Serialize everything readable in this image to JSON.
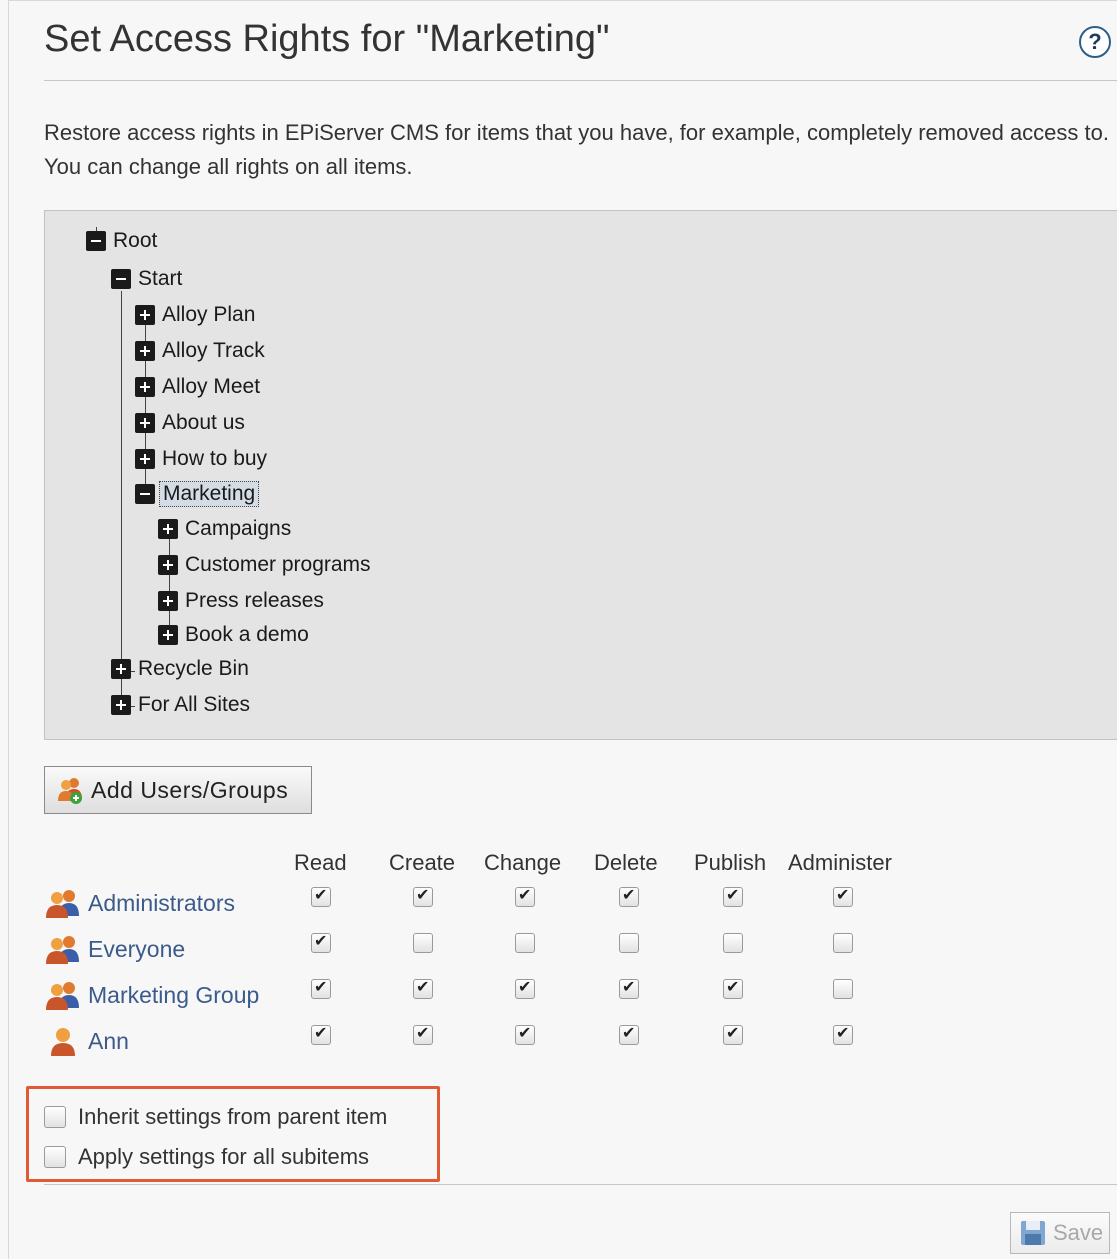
{
  "dialog": {
    "title": "Set Access Rights for \"Marketing\"",
    "help_icon": "?",
    "description": "Restore access rights in EPiServer CMS for items that you have, for example, completely removed access to. You can change all rights on all items."
  },
  "tree": {
    "root": "Root",
    "start": "Start",
    "start_children": [
      "Alloy Plan",
      "Alloy Track",
      "Alloy Meet",
      "About us",
      "How to buy"
    ],
    "selected": "Marketing",
    "marketing_children": [
      "Campaigns",
      "Customer programs",
      "Press releases",
      "Book a demo"
    ],
    "root_children_after": [
      "Recycle Bin",
      "For All Sites"
    ]
  },
  "add_button": {
    "label": "Add Users/Groups",
    "icon": "add-group-icon"
  },
  "permissions": {
    "columns": [
      "Read",
      "Create",
      "Change",
      "Delete",
      "Publish",
      "Administer"
    ],
    "rows": [
      {
        "name": "Administrators",
        "type": "group",
        "checks": [
          true,
          true,
          true,
          true,
          true,
          true
        ]
      },
      {
        "name": "Everyone",
        "type": "group",
        "checks": [
          true,
          false,
          false,
          false,
          false,
          false
        ]
      },
      {
        "name": "Marketing Group",
        "type": "group",
        "checks": [
          true,
          true,
          true,
          true,
          true,
          false
        ]
      },
      {
        "name": "Ann",
        "type": "user",
        "checks": [
          true,
          true,
          true,
          true,
          true,
          true
        ]
      }
    ]
  },
  "options": {
    "inherit_label": "Inherit settings from parent item",
    "inherit_checked": false,
    "apply_label": "Apply settings for all subitems",
    "apply_checked": false
  },
  "save_button": {
    "label": "Save",
    "enabled": false,
    "icon": "floppy-disk-icon"
  },
  "colors": {
    "highlight": "#e05a35",
    "link": "#3b5b8a",
    "tree_bg": "#e4e4e4"
  }
}
